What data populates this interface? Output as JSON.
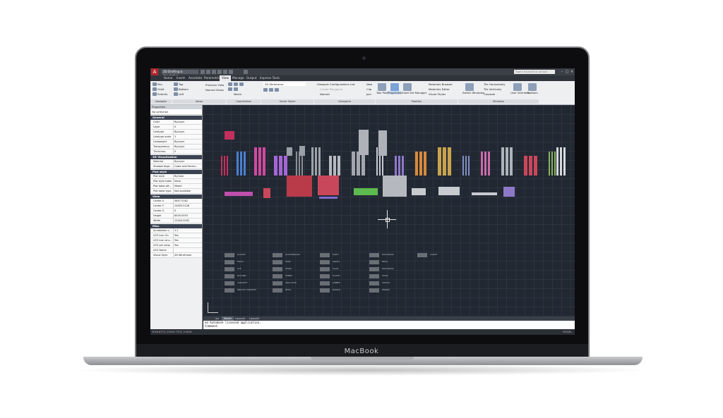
{
  "device": {
    "brand": "MacBook"
  },
  "app": {
    "logo": "A",
    "workspace": "2D Drafting & Annotation",
    "search_placeholder": "Type a keyword or phrase",
    "tabs": [
      "Home",
      "Insert",
      "Annotate",
      "Parametric",
      "View",
      "Manage",
      "Output",
      "Express Tools"
    ],
    "active_tab": "View"
  },
  "ribbon": {
    "navigate": {
      "items": [
        "Pan",
        "Orbit",
        "Extents"
      ],
      "label": "Navigate"
    },
    "views": {
      "items": [
        "Top",
        "Bottom",
        "Left",
        "Previous View",
        "Named Views"
      ],
      "label": "Views"
    },
    "coordinates": {
      "items": [
        "World"
      ],
      "label": "Coordinates"
    },
    "visual_styles": {
      "combo": "2D Wireframe",
      "label": "Visual Styles"
    },
    "viewports": {
      "items": [
        "Viewport Configurations List",
        "Create Polygonal",
        "Named",
        "New",
        "Clip",
        "Join"
      ],
      "label": "Viewports"
    },
    "palettes": {
      "items": [
        "Tool Palettes",
        "Properties",
        "Sheet Set Manager",
        "Materials Browser",
        "Materials Editor",
        "Visual Styles"
      ],
      "label": "Palettes"
    },
    "windows": {
      "items": [
        "Switch Windows",
        "Tile Horizontally",
        "Tile Vertically",
        "Cascade",
        "User Interface",
        "Toolbars"
      ],
      "label": "Windows"
    }
  },
  "properties": {
    "title": "Properties",
    "selection": "No selection",
    "sections": [
      {
        "name": "General",
        "rows": [
          [
            "Color",
            "ByLayer"
          ],
          [
            "Layer",
            "0"
          ],
          [
            "Linetype",
            "ByLayer"
          ],
          [
            "Linetype scale",
            "1"
          ],
          [
            "Lineweight",
            "ByLayer"
          ],
          [
            "Transparency",
            "ByLayer"
          ],
          [
            "Thickness",
            "0"
          ]
        ]
      },
      {
        "name": "3D Visualization",
        "rows": [
          [
            "Material",
            "ByLayer"
          ],
          [
            "Shadow displ...",
            "Casts and Receiv..."
          ]
        ]
      },
      {
        "name": "Plot style",
        "rows": [
          [
            "Plot style",
            "ByColor"
          ],
          [
            "Plot style table",
            "None"
          ],
          [
            "Plot table att...",
            "Model"
          ],
          [
            "Plot table type",
            "Not available"
          ]
        ]
      },
      {
        "name": "View",
        "rows": [
          [
            "Center X",
            "5847.5162"
          ],
          [
            "Center Y",
            "24903.5128"
          ],
          [
            "Center Z",
            "0"
          ],
          [
            "Height",
            "6509.0593"
          ],
          [
            "Width",
            "12004.5092"
          ]
        ]
      },
      {
        "name": "Misc",
        "rows": [
          [
            "Annotation s...",
            "1:1"
          ],
          [
            "UCS icon On",
            "Yes"
          ],
          [
            "UCS icon at o...",
            "Yes"
          ],
          [
            "UCS per view...",
            "Yes"
          ],
          [
            "UCS Name",
            ""
          ],
          [
            "Visual Style",
            "2D Wireframe"
          ]
        ]
      }
    ]
  },
  "legend_labels": [
    [
      "PLASTER",
      "FINISH",
      "TILE",
      "MASONRY",
      "CONCRETE",
      "PRECAST CONCRETE"
    ],
    [
      "PLASTERBOARD",
      "STEEL",
      "STONE",
      "TIMBER",
      "INSULATION",
      "METAL"
    ],
    [
      "EARTH",
      "GRAVEL",
      "GLASS",
      "PLASTIC",
      "RUBBER",
      "MORTAR"
    ],
    [
      "BLOCKWORK",
      "BRICK",
      "BLOCKWORK",
      "WOOD",
      "ASPHALT",
      "RENDER"
    ],
    [
      "CARPET"
    ]
  ],
  "layout_tabs": [
    "Model",
    "Layout1",
    "Layout2"
  ],
  "active_layout": "Model",
  "command": {
    "history": "ed Autodesk licensed application.",
    "prompt": "Command:"
  },
  "status": {
    "coords": "3018.6374, 22910.7374, 0.0000",
    "right": "MODEL"
  },
  "colors": {
    "canvas": "#222832",
    "ribbon": "#eeeff1",
    "accent": "#b3262b"
  }
}
